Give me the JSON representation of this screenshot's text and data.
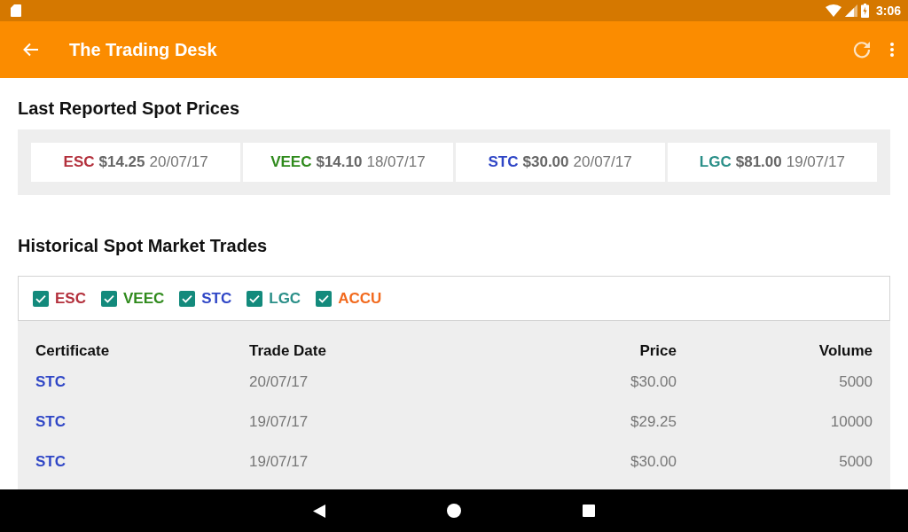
{
  "status_bar": {
    "time": "3:06"
  },
  "app_bar": {
    "title": "The Trading Desk"
  },
  "spot_prices": {
    "title": "Last Reported Spot Prices",
    "items": [
      {
        "certificate": "ESC",
        "color": "#b3303c",
        "price": "$14.25",
        "date": "20/07/17"
      },
      {
        "certificate": "VEEC",
        "color": "#2f8a1c",
        "price": "$14.10",
        "date": "18/07/17"
      },
      {
        "certificate": "STC",
        "color": "#2f46c6",
        "price": "$30.00",
        "date": "20/07/17"
      },
      {
        "certificate": "LGC",
        "color": "#2a8f88",
        "price": "$81.00",
        "date": "19/07/17"
      }
    ]
  },
  "trades": {
    "title": "Historical Spot Market Trades",
    "filters": [
      {
        "label": "ESC",
        "color": "#b3303c",
        "checked": true
      },
      {
        "label": "VEEC",
        "color": "#2f8a1c",
        "checked": true
      },
      {
        "label": "STC",
        "color": "#2f46c6",
        "checked": true
      },
      {
        "label": "LGC",
        "color": "#2a8f88",
        "checked": true
      },
      {
        "label": "ACCU",
        "color": "#f26a1e",
        "checked": true
      }
    ],
    "table": {
      "columns": [
        "Certificate",
        "Trade Date",
        "Price",
        "Volume"
      ],
      "rows": [
        {
          "certificate": "STC",
          "color": "#2f46c6",
          "trade_date": "20/07/17",
          "price": "$30.00",
          "volume": "5000"
        },
        {
          "certificate": "STC",
          "color": "#2f46c6",
          "trade_date": "19/07/17",
          "price": "$29.25",
          "volume": "10000"
        },
        {
          "certificate": "STC",
          "color": "#2f46c6",
          "trade_date": "19/07/17",
          "price": "$30.00",
          "volume": "5000"
        }
      ]
    }
  }
}
